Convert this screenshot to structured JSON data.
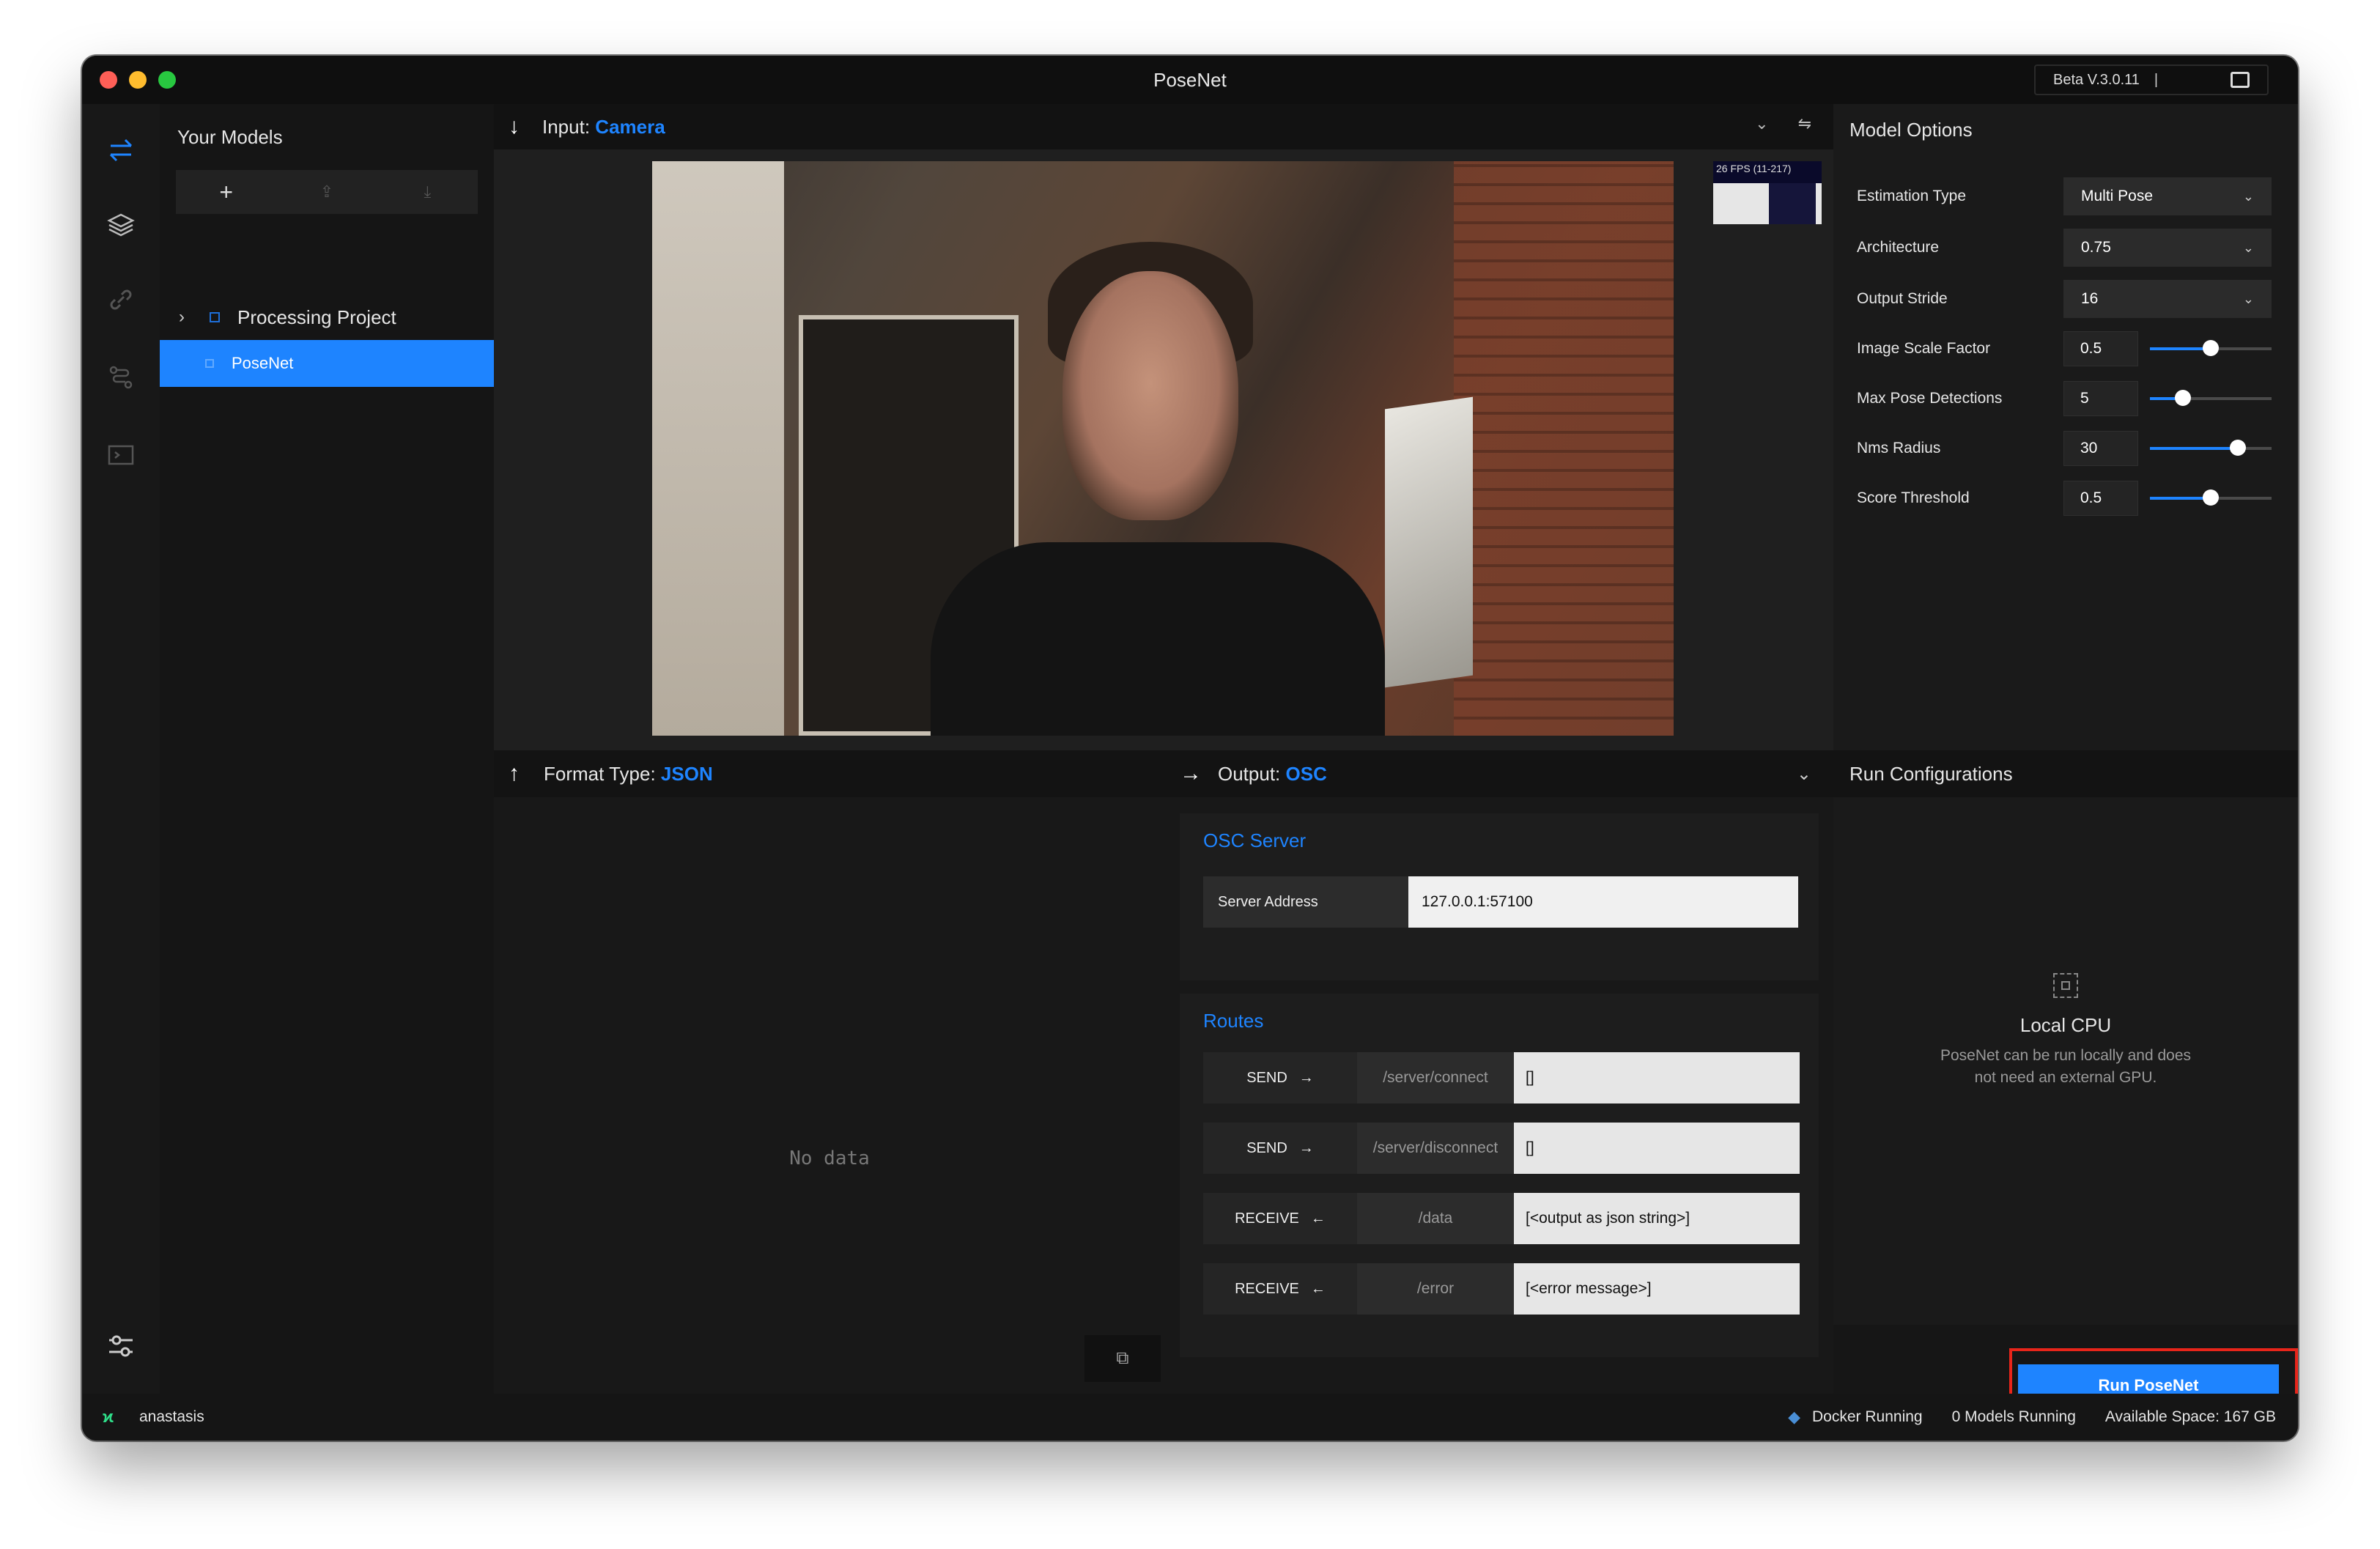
{
  "window": {
    "title": "PoseNet",
    "version": "Beta V.3.0.11",
    "version_sep": "|"
  },
  "models_panel": {
    "title": "Your Models",
    "add_label": "+",
    "project": {
      "name": "Processing Project"
    },
    "selected_model": "PoseNet"
  },
  "input": {
    "label": "Input:",
    "source": "Camera",
    "fps_label": "26 FPS (11-217)"
  },
  "model_options": {
    "title": "Model Options",
    "selects": [
      {
        "label": "Estimation Type",
        "value": "Multi Pose"
      },
      {
        "label": "Architecture",
        "value": "0.75"
      },
      {
        "label": "Output Stride",
        "value": "16"
      }
    ],
    "sliders": [
      {
        "label": "Image Scale Factor",
        "value": "0.5",
        "level": 0.5
      },
      {
        "label": "Max Pose Detections",
        "value": "5",
        "level": 0.27
      },
      {
        "label": "Nms Radius",
        "value": "30",
        "level": 0.72
      },
      {
        "label": "Score Threshold",
        "value": "0.5",
        "level": 0.5
      }
    ]
  },
  "format": {
    "label": "Format Type:",
    "value": "JSON",
    "empty_text": "No data"
  },
  "output": {
    "label": "Output:",
    "value": "OSC",
    "osc_server": {
      "title": "OSC Server",
      "address_label": "Server Address",
      "address_value": "127.0.0.1:57100"
    },
    "routes": {
      "title": "Routes",
      "items": [
        {
          "direction": "SEND",
          "arrow": "→",
          "path": "/server/connect",
          "value": "[]"
        },
        {
          "direction": "SEND",
          "arrow": "→",
          "path": "/server/disconnect",
          "value": "[]"
        },
        {
          "direction": "RECEIVE",
          "arrow": "←",
          "path": "/data",
          "value": "[<output as json string>]"
        },
        {
          "direction": "RECEIVE",
          "arrow": "←",
          "path": "/error",
          "value": "[<error message>]"
        }
      ]
    }
  },
  "run_config": {
    "title": "Run Configurations",
    "cpu_title": "Local CPU",
    "cpu_desc": "PoseNet can be run locally and does not need an external GPU.",
    "run_button": "Run PoseNet"
  },
  "status_bar": {
    "user": "anastasis",
    "docker": "Docker Running",
    "models_running": "0 Models Running",
    "space": "Available Space: 167 GB"
  },
  "colors": {
    "accent": "#1e84ff",
    "highlight": "#e8251a",
    "status_logo": "#2fe08a"
  }
}
